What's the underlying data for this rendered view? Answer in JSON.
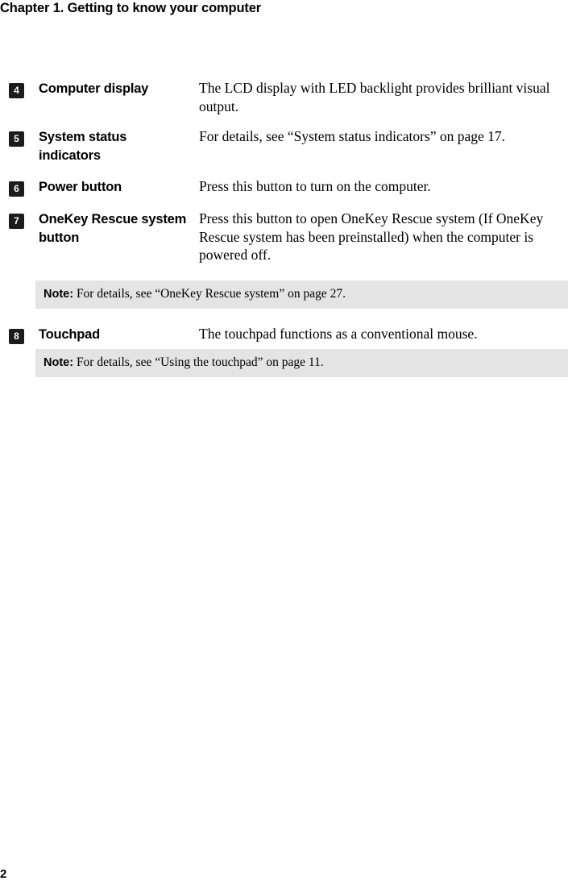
{
  "header": {
    "title": "Chapter 1. Getting to know your computer"
  },
  "callouts": [
    {
      "number": "4",
      "label": "Computer display",
      "description": "The LCD display with LED backlight provides brilliant visual output."
    },
    {
      "number": "5",
      "label": "System status indicators",
      "description": "For details, see “System status indicators” on page 17."
    },
    {
      "number": "6",
      "label": "Power button",
      "description": "Press this button to turn on the computer."
    },
    {
      "number": "7",
      "label": "OneKey Rescue system button",
      "description": "Press this button to open OneKey Rescue system (If OneKey Rescue system has been preinstalled) when the computer is powered off."
    },
    {
      "number": "8",
      "label": "Touchpad",
      "description": "The touchpad functions as a conventional mouse."
    }
  ],
  "notes": [
    {
      "label": "Note:",
      "text": " For details, see “OneKey Rescue system” on page 27."
    },
    {
      "label": "Note:",
      "text": " For details, see “Using the touchpad” on page 11."
    }
  ],
  "footer": {
    "page_number": "2"
  },
  "colors": {
    "badge_background": "#1c1c1c",
    "badge_text": "#ffffff",
    "note_background": "#e4e4e4",
    "body_text": "#000000",
    "page_background": "#ffffff"
  }
}
